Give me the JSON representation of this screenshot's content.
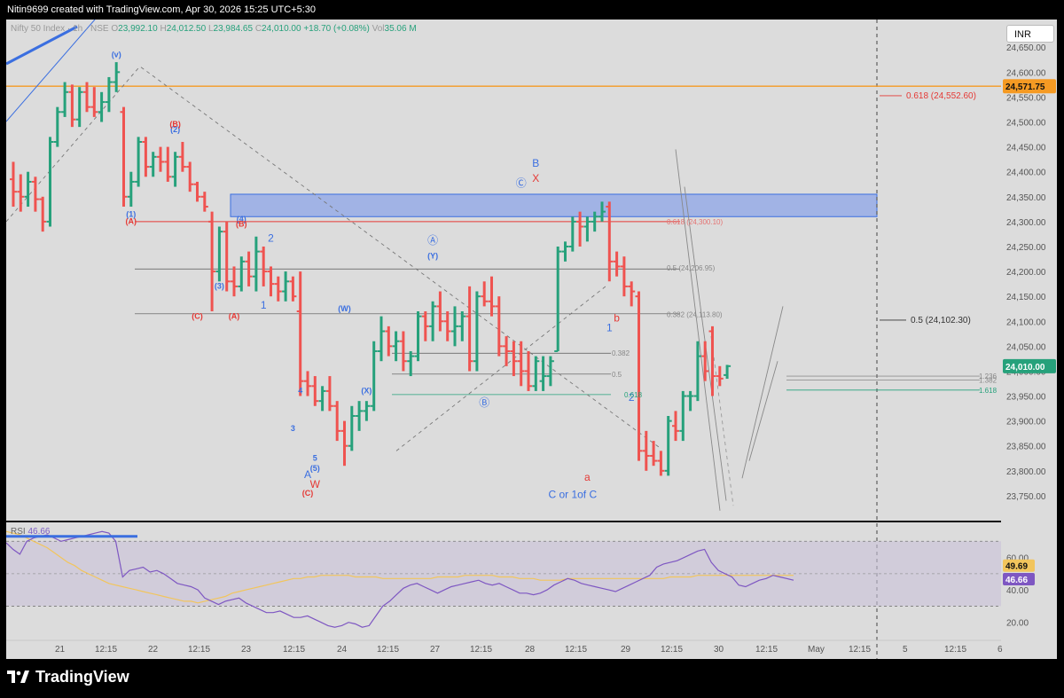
{
  "header": {
    "title": "Nitin9699 created with TradingView.com, Apr 30, 2026 15:25 UTC+5:30"
  },
  "legend": {
    "symbol": "Nifty 50 Index · 1h · NSE",
    "open_label": "O",
    "open": "23,992.10",
    "high_label": "H",
    "high": "24,012.50",
    "low_label": "L",
    "low": "23,984.65",
    "close_label": "C",
    "close": "24,010.00",
    "change": "+18.70 (+0.08%)",
    "vol_label": "Vol",
    "vol": "35.06 M"
  },
  "currency_button": "INR",
  "rsi_legend": {
    "name": "RSI",
    "value": "46.66"
  },
  "brand": {
    "name": "TradingView"
  },
  "colors": {
    "up": "#26a17b",
    "down": "#ef5350",
    "orange": "#f59a23",
    "zone": "#8ea6e8",
    "rsi": "#7e57c2",
    "rsi_ma": "#f2c55c",
    "wave_blue": "#3b6fe0",
    "wave_red": "#e53935"
  },
  "chart_data": {
    "type": "candlestick",
    "timeframe": "1h",
    "y_range": [
      23700,
      24670
    ],
    "price_ticks": [
      "24,650.00",
      "24,600.00",
      "24,550.00",
      "24,500.00",
      "24,450.00",
      "24,400.00",
      "24,350.00",
      "24,300.00",
      "24,250.00",
      "24,200.00",
      "24,150.00",
      "24,100.00",
      "24,050.00",
      "24,000.00",
      "23,950.00",
      "23,900.00",
      "23,850.00",
      "23,800.00",
      "23,750.00"
    ],
    "price_tick_values": [
      24650,
      24600,
      24550,
      24500,
      24450,
      24400,
      24350,
      24300,
      24250,
      24200,
      24150,
      24100,
      24050,
      24000,
      23950,
      23900,
      23850,
      23800,
      23750
    ],
    "x_ticks": [
      "21",
      "12:15",
      "22",
      "12:15",
      "23",
      "12:15",
      "24",
      "12:15",
      "27",
      "12:15",
      "28",
      "12:15",
      "29",
      "12:15",
      "30",
      "12:15",
      "May",
      "12:15",
      "5",
      "12:15",
      "6"
    ],
    "bars": [
      {
        "o": 24385,
        "h": 24420,
        "l": 24330,
        "c": 24360
      },
      {
        "o": 24360,
        "h": 24395,
        "l": 24320,
        "c": 24350
      },
      {
        "o": 24350,
        "h": 24400,
        "l": 24330,
        "c": 24380
      },
      {
        "o": 24380,
        "h": 24390,
        "l": 24320,
        "c": 24345
      },
      {
        "o": 24345,
        "h": 24350,
        "l": 24280,
        "c": 24300
      },
      {
        "o": 24300,
        "h": 24470,
        "l": 24290,
        "c": 24460
      },
      {
        "o": 24460,
        "h": 24530,
        "l": 24450,
        "c": 24520
      },
      {
        "o": 24520,
        "h": 24580,
        "l": 24510,
        "c": 24560
      },
      {
        "o": 24560,
        "h": 24575,
        "l": 24490,
        "c": 24505
      },
      {
        "o": 24505,
        "h": 24570,
        "l": 24490,
        "c": 24560
      },
      {
        "o": 24560,
        "h": 24580,
        "l": 24520,
        "c": 24530
      },
      {
        "o": 24530,
        "h": 24570,
        "l": 24510,
        "c": 24520
      },
      {
        "o": 24520,
        "h": 24560,
        "l": 24500,
        "c": 24540
      },
      {
        "o": 24540,
        "h": 24590,
        "l": 24520,
        "c": 24580
      },
      {
        "o": 24580,
        "h": 24620,
        "l": 24560,
        "c": 24600
      },
      {
        "o": 24520,
        "h": 24530,
        "l": 24330,
        "c": 24350
      },
      {
        "o": 24350,
        "h": 24400,
        "l": 24330,
        "c": 24380
      },
      {
        "o": 24380,
        "h": 24470,
        "l": 24370,
        "c": 24460
      },
      {
        "o": 24460,
        "h": 24470,
        "l": 24390,
        "c": 24410
      },
      {
        "o": 24410,
        "h": 24440,
        "l": 24390,
        "c": 24430
      },
      {
        "o": 24430,
        "h": 24450,
        "l": 24400,
        "c": 24420
      },
      {
        "o": 24420,
        "h": 24450,
        "l": 24380,
        "c": 24390
      },
      {
        "o": 24390,
        "h": 24440,
        "l": 24370,
        "c": 24430
      },
      {
        "o": 24430,
        "h": 24460,
        "l": 24400,
        "c": 24410
      },
      {
        "o": 24410,
        "h": 24420,
        "l": 24360,
        "c": 24375
      },
      {
        "o": 24375,
        "h": 24380,
        "l": 24340,
        "c": 24350
      },
      {
        "o": 24350,
        "h": 24360,
        "l": 24320,
        "c": 24330
      },
      {
        "o": 24300,
        "h": 24320,
        "l": 24120,
        "c": 24200
      },
      {
        "o": 24200,
        "h": 24290,
        "l": 24180,
        "c": 24280
      },
      {
        "o": 24280,
        "h": 24300,
        "l": 24160,
        "c": 24180
      },
      {
        "o": 24180,
        "h": 24210,
        "l": 24150,
        "c": 24170
      },
      {
        "o": 24170,
        "h": 24230,
        "l": 24160,
        "c": 24220
      },
      {
        "o": 24220,
        "h": 24240,
        "l": 24170,
        "c": 24190
      },
      {
        "o": 24190,
        "h": 24270,
        "l": 24160,
        "c": 24240
      },
      {
        "o": 24240,
        "h": 24250,
        "l": 24170,
        "c": 24200
      },
      {
        "o": 24200,
        "h": 24210,
        "l": 24150,
        "c": 24175
      },
      {
        "o": 24175,
        "h": 24190,
        "l": 24140,
        "c": 24160
      },
      {
        "o": 24160,
        "h": 24200,
        "l": 24140,
        "c": 24180
      },
      {
        "o": 24180,
        "h": 24190,
        "l": 24140,
        "c": 24150
      },
      {
        "o": 24120,
        "h": 24200,
        "l": 23950,
        "c": 23980
      },
      {
        "o": 23980,
        "h": 24000,
        "l": 23950,
        "c": 23970
      },
      {
        "o": 23970,
        "h": 23990,
        "l": 23930,
        "c": 23940
      },
      {
        "o": 23940,
        "h": 23970,
        "l": 23920,
        "c": 23960
      },
      {
        "o": 23960,
        "h": 23990,
        "l": 23920,
        "c": 23930
      },
      {
        "o": 23930,
        "h": 23940,
        "l": 23860,
        "c": 23880
      },
      {
        "o": 23880,
        "h": 23900,
        "l": 23810,
        "c": 23850
      },
      {
        "o": 23850,
        "h": 23930,
        "l": 23840,
        "c": 23910
      },
      {
        "o": 23910,
        "h": 23940,
        "l": 23880,
        "c": 23920
      },
      {
        "o": 23920,
        "h": 23940,
        "l": 23900,
        "c": 23930
      },
      {
        "o": 23930,
        "h": 24060,
        "l": 23920,
        "c": 24040
      },
      {
        "o": 24040,
        "h": 24110,
        "l": 24020,
        "c": 24080
      },
      {
        "o": 24080,
        "h": 24090,
        "l": 24030,
        "c": 24050
      },
      {
        "o": 24050,
        "h": 24080,
        "l": 24020,
        "c": 24060
      },
      {
        "o": 24060,
        "h": 24080,
        "l": 24000,
        "c": 24020
      },
      {
        "o": 24020,
        "h": 24040,
        "l": 23990,
        "c": 24030
      },
      {
        "o": 24030,
        "h": 24120,
        "l": 24020,
        "c": 24110
      },
      {
        "o": 24110,
        "h": 24120,
        "l": 24060,
        "c": 24090
      },
      {
        "o": 24090,
        "h": 24140,
        "l": 24060,
        "c": 24130
      },
      {
        "o": 24130,
        "h": 24160,
        "l": 24080,
        "c": 24100
      },
      {
        "o": 24100,
        "h": 24120,
        "l": 24060,
        "c": 24080
      },
      {
        "o": 24080,
        "h": 24130,
        "l": 24050,
        "c": 24090
      },
      {
        "o": 24090,
        "h": 24120,
        "l": 24060,
        "c": 24110
      },
      {
        "o": 24110,
        "h": 24170,
        "l": 24000,
        "c": 24020
      },
      {
        "o": 24020,
        "h": 24160,
        "l": 24000,
        "c": 24150
      },
      {
        "o": 24150,
        "h": 24180,
        "l": 24130,
        "c": 24140
      },
      {
        "o": 24140,
        "h": 24190,
        "l": 24110,
        "c": 24130
      },
      {
        "o": 24130,
        "h": 24150,
        "l": 24030,
        "c": 24050
      },
      {
        "o": 24050,
        "h": 24070,
        "l": 24010,
        "c": 24040
      },
      {
        "o": 24040,
        "h": 24060,
        "l": 23990,
        "c": 24020
      },
      {
        "o": 24020,
        "h": 24060,
        "l": 23970,
        "c": 24000
      },
      {
        "o": 24000,
        "h": 24040,
        "l": 23960,
        "c": 23970
      },
      {
        "o": 23970,
        "h": 24030,
        "l": 23960,
        "c": 24020
      },
      {
        "o": 23980,
        "h": 24030,
        "l": 23960,
        "c": 23990
      },
      {
        "o": 23990,
        "h": 24030,
        "l": 23970,
        "c": 24020
      },
      {
        "o": 24040,
        "h": 24250,
        "l": 24040,
        "c": 24240
      },
      {
        "o": 24240,
        "h": 24260,
        "l": 24220,
        "c": 24250
      },
      {
        "o": 24250,
        "h": 24310,
        "l": 24240,
        "c": 24300
      },
      {
        "o": 24300,
        "h": 24320,
        "l": 24250,
        "c": 24290
      },
      {
        "o": 24290,
        "h": 24310,
        "l": 24260,
        "c": 24300
      },
      {
        "o": 24300,
        "h": 24320,
        "l": 24280,
        "c": 24310
      },
      {
        "o": 24310,
        "h": 24340,
        "l": 24300,
        "c": 24320
      },
      {
        "o": 24330,
        "h": 24340,
        "l": 24180,
        "c": 24220
      },
      {
        "o": 24220,
        "h": 24240,
        "l": 24190,
        "c": 24210
      },
      {
        "o": 24210,
        "h": 24230,
        "l": 24150,
        "c": 24170
      },
      {
        "o": 24170,
        "h": 24180,
        "l": 24130,
        "c": 24160
      },
      {
        "o": 24150,
        "h": 24160,
        "l": 23820,
        "c": 23840
      },
      {
        "o": 23840,
        "h": 23880,
        "l": 23800,
        "c": 23830
      },
      {
        "o": 23830,
        "h": 23860,
        "l": 23810,
        "c": 23820
      },
      {
        "o": 23820,
        "h": 23840,
        "l": 23790,
        "c": 23800
      },
      {
        "o": 23800,
        "h": 23910,
        "l": 23790,
        "c": 23900
      },
      {
        "o": 23890,
        "h": 23920,
        "l": 23860,
        "c": 23880
      },
      {
        "o": 23880,
        "h": 23960,
        "l": 23860,
        "c": 23950
      },
      {
        "o": 23950,
        "h": 23960,
        "l": 23920,
        "c": 23950
      },
      {
        "o": 23950,
        "h": 24060,
        "l": 23940,
        "c": 24030
      },
      {
        "o": 24030,
        "h": 24060,
        "l": 23980,
        "c": 24000
      },
      {
        "o": 24080,
        "h": 24090,
        "l": 23950,
        "c": 23990
      },
      {
        "o": 23990,
        "h": 24010,
        "l": 23970,
        "c": 23985
      },
      {
        "o": 23992.1,
        "h": 24012.5,
        "l": 23984.65,
        "c": 24010
      }
    ],
    "horizontal_levels": [
      {
        "price": 24571.75,
        "label": "24,571.75",
        "color": "#f59a23"
      },
      {
        "price": 24300,
        "color": "#e53935"
      },
      {
        "price": 24010,
        "label": "24,010.00",
        "color": "#26a17b"
      }
    ],
    "zone": {
      "from": 24310,
      "to": 24355
    },
    "fib_labels": [
      {
        "text": "0.618 (24,552.60)",
        "price": 24552.6,
        "color": "#e53935"
      },
      {
        "text": "0.5 (24,102.30)",
        "price": 24102.3,
        "color": "#333333"
      },
      {
        "text": "0.618 (24,300.10)",
        "price": 24300.1,
        "color": "#e57373"
      },
      {
        "text": "0.5 (24,206.95)",
        "price": 24206.95,
        "color": "#888888"
      },
      {
        "text": "0.382 (24,113.80)",
        "price": 24113.8,
        "color": "#888888"
      },
      {
        "text": "0.382",
        "price": 24036,
        "color": "#888888"
      },
      {
        "text": "0.5",
        "price": 23994,
        "color": "#888888"
      },
      {
        "text": "0.618",
        "price": 23953,
        "color": "#26a17b"
      },
      {
        "text": "1.236",
        "price": 23990,
        "color": "#888888"
      },
      {
        "text": "1.382",
        "price": 23982,
        "color": "#888888"
      },
      {
        "text": "1.618",
        "price": 23962,
        "color": "#26a17b"
      }
    ],
    "wave_labels": [
      {
        "text": "(v)",
        "bar": 14,
        "price": 24630,
        "color": "#3b6fe0"
      },
      {
        "text": "(1)",
        "bar": 16,
        "price": 24310,
        "color": "#3b6fe0"
      },
      {
        "text": "(A)",
        "bar": 16,
        "price": 24295,
        "color": "#e53935"
      },
      {
        "text": "(2)",
        "bar": 22,
        "price": 24480,
        "color": "#3b6fe0"
      },
      {
        "text": "(B)",
        "bar": 22,
        "price": 24490,
        "color": "#e53935"
      },
      {
        "text": "(3)",
        "bar": 28,
        "price": 24165,
        "color": "#3b6fe0"
      },
      {
        "text": "(C)",
        "bar": 25,
        "price": 24105,
        "color": "#e53935"
      },
      {
        "text": "(4)",
        "bar": 31,
        "price": 24300,
        "color": "#3b6fe0"
      },
      {
        "text": "(B)",
        "bar": 31,
        "price": 24290,
        "color": "#e53935"
      },
      {
        "text": "(A)",
        "bar": 30,
        "price": 24105,
        "color": "#e53935"
      },
      {
        "text": "1",
        "bar": 34,
        "price": 24125,
        "color": "#3b6fe0"
      },
      {
        "text": "2",
        "bar": 35,
        "price": 24260,
        "color": "#3b6fe0"
      },
      {
        "text": "3",
        "bar": 38,
        "price": 23880,
        "color": "#3b6fe0"
      },
      {
        "text": "4",
        "bar": 39,
        "price": 23955,
        "color": "#3b6fe0"
      },
      {
        "text": "5",
        "bar": 41,
        "price": 23820,
        "color": "#3b6fe0"
      },
      {
        "text": "(5)",
        "bar": 41,
        "price": 23800,
        "color": "#3b6fe0"
      },
      {
        "text": "A",
        "bar": 40,
        "price": 23785,
        "color": "#3b6fe0"
      },
      {
        "text": "W",
        "bar": 41,
        "price": 23766,
        "color": "#e53935"
      },
      {
        "text": "(C)",
        "bar": 40,
        "price": 23750,
        "color": "#e53935"
      },
      {
        "text": "(W)",
        "bar": 45,
        "price": 24120,
        "color": "#3b6fe0"
      },
      {
        "text": "(X)",
        "bar": 48,
        "price": 23955,
        "color": "#3b6fe0"
      },
      {
        "text": "Ⓐ",
        "bar": 57,
        "price": 24255,
        "color": "#3b6fe0"
      },
      {
        "text": "(Y)",
        "bar": 57,
        "price": 24226,
        "color": "#3b6fe0"
      },
      {
        "text": "Ⓑ",
        "bar": 64,
        "price": 23930,
        "color": "#3b6fe0"
      },
      {
        "text": "Ⓒ",
        "bar": 69,
        "price": 24370,
        "color": "#3b6fe0"
      },
      {
        "text": "B",
        "bar": 71,
        "price": 24410,
        "color": "#3b6fe0"
      },
      {
        "text": "X",
        "bar": 71,
        "price": 24380,
        "color": "#e53935"
      },
      {
        "text": "C or 1of C",
        "bar": 76,
        "price": 23745,
        "color": "#3b6fe0"
      },
      {
        "text": "a",
        "bar": 78,
        "price": 23780,
        "color": "#e53935"
      },
      {
        "text": "1",
        "bar": 81,
        "price": 24080,
        "color": "#3b6fe0"
      },
      {
        "text": "b",
        "bar": 82,
        "price": 24100,
        "color": "#e53935"
      },
      {
        "text": "2",
        "bar": 84,
        "price": 23940,
        "color": "#3b6fe0"
      }
    ],
    "rsi": {
      "range": [
        10,
        80
      ],
      "ticks": [
        "60.00",
        "40.00",
        "20.00"
      ],
      "tick_values": [
        60,
        40,
        20
      ],
      "band": [
        30,
        70
      ],
      "mid": 50,
      "values": [
        69,
        65,
        62,
        70,
        72,
        73,
        74,
        72,
        70,
        71,
        72,
        73,
        74,
        75,
        76,
        75,
        70,
        48,
        52,
        53,
        54,
        51,
        52,
        50,
        47,
        44,
        43,
        42,
        40,
        35,
        33,
        31,
        33,
        34,
        35,
        32,
        30,
        28,
        26,
        26,
        27,
        25,
        23,
        23,
        24,
        22,
        20,
        18,
        17,
        18,
        20,
        19,
        17,
        18,
        24,
        30,
        33,
        37,
        41,
        43,
        44,
        42,
        40,
        38,
        40,
        42,
        43,
        44,
        45,
        46,
        44,
        43,
        44,
        42,
        40,
        38,
        38,
        37,
        38,
        40,
        43,
        45,
        47,
        46,
        44,
        43,
        42,
        41,
        40,
        39,
        41,
        43,
        45,
        47,
        49,
        54,
        56,
        57,
        58,
        60,
        62,
        64,
        65,
        57,
        52,
        50,
        48,
        43,
        42,
        44,
        46,
        47,
        49,
        48,
        47,
        46
      ],
      "ma_values": [
        76,
        75,
        74,
        72,
        70,
        68,
        66,
        63,
        60,
        57,
        55,
        52,
        50,
        48,
        46,
        44,
        43,
        42,
        41,
        40,
        39,
        38,
        37,
        36,
        35,
        34,
        33,
        33,
        32,
        33,
        34,
        35,
        36,
        38,
        39,
        40,
        41,
        42,
        43,
        44,
        45,
        46,
        47,
        47,
        48,
        48,
        49,
        49,
        49,
        49,
        49,
        48,
        48,
        48,
        48,
        47,
        47,
        47,
        47,
        47,
        47,
        47,
        47,
        48,
        48,
        48,
        48,
        49,
        49,
        49,
        49,
        49,
        48,
        48,
        48,
        47,
        47,
        47,
        46,
        46,
        46,
        46,
        47,
        47,
        47,
        47,
        47,
        47,
        47,
        47,
        47,
        47,
        47,
        47,
        47,
        47,
        47,
        48,
        48,
        48,
        48,
        49,
        49,
        49,
        49,
        49,
        49,
        49,
        49,
        49,
        49,
        49,
        49,
        49,
        49,
        49
      ],
      "last_value": "46.66",
      "ma_last": "49.69"
    }
  }
}
